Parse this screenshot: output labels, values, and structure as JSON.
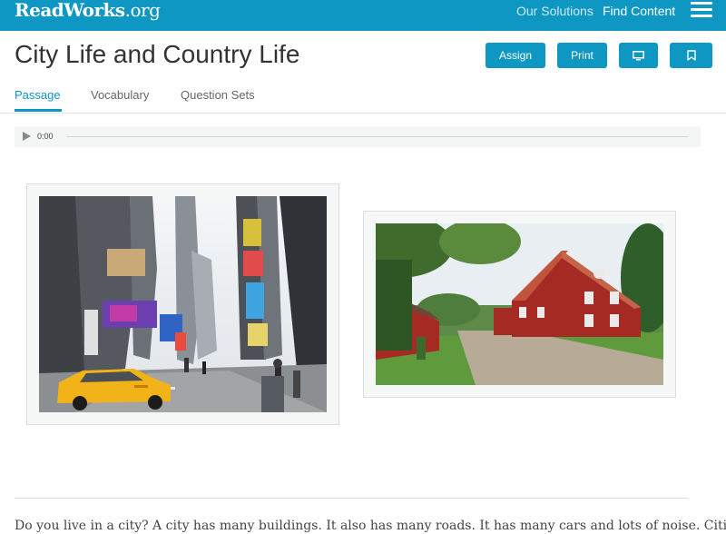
{
  "nav": {
    "logo_main": "ReadWorks",
    "logo_suffix": ".org",
    "links": [
      "Our Solutions",
      "Find Content"
    ]
  },
  "header": {
    "title": "City Life and Country Life",
    "buttons": {
      "assign": "Assign",
      "print": "Print"
    }
  },
  "tabs": [
    {
      "label": "Passage",
      "active": true
    },
    {
      "label": "Vocabulary",
      "active": false
    },
    {
      "label": "Question Sets",
      "active": false
    }
  ],
  "audio": {
    "time": "0:00",
    "progress": 0
  },
  "passage": {
    "text": "Do you live in a city? A city has many buildings. It also has many roads. It has many cars and lots of noise. Cities"
  },
  "colors": {
    "brand": "#0d97c2",
    "barn_red": "#a52a24"
  },
  "icons": {
    "present": "monitor-icon",
    "bookmark": "bookmark-icon",
    "menu": "hamburger-menu-icon",
    "play": "play-icon"
  }
}
